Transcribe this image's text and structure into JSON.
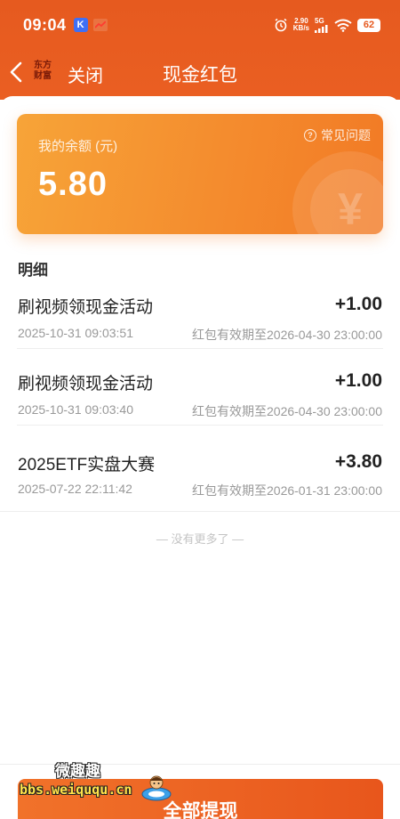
{
  "status_bar": {
    "time": "09:04",
    "app_badge": "K",
    "net_speed_value": "2.90",
    "net_speed_unit": "KB/s",
    "network": "5G",
    "battery": "62"
  },
  "nav": {
    "logo_line1": "东方",
    "logo_line2": "财富",
    "close_label": "关闭",
    "title": "现金红包"
  },
  "balance_card": {
    "label": "我的余额 (元)",
    "value": "5.80",
    "faq_label": "常见问题",
    "coin_symbol": "¥"
  },
  "details": {
    "section_title": "明细",
    "records": [
      {
        "title": "刷视频领现金活动",
        "amount": "+1.00",
        "date": "2025-10-31 09:03:51",
        "expire": "红包有效期至2026-04-30 23:00:00"
      },
      {
        "title": "刷视频领现金活动",
        "amount": "+1.00",
        "date": "2025-10-31 09:03:40",
        "expire": "红包有效期至2026-04-30 23:00:00"
      },
      {
        "title": "2025ETF实盘大赛",
        "amount": "+3.80",
        "date": "2025-07-22 22:11:42",
        "expire": "红包有效期至2026-01-31 23:00:00"
      }
    ],
    "no_more": "— 没有更多了 —"
  },
  "footer": {
    "withdraw_label": "全部提现"
  },
  "watermark": {
    "title": "微趣趣",
    "url": "bbs.weiququ.cn"
  },
  "colors": {
    "header": "#e65a1f",
    "card_start": "#f7a438",
    "card_end": "#f27a25",
    "button": "#e8561c"
  }
}
